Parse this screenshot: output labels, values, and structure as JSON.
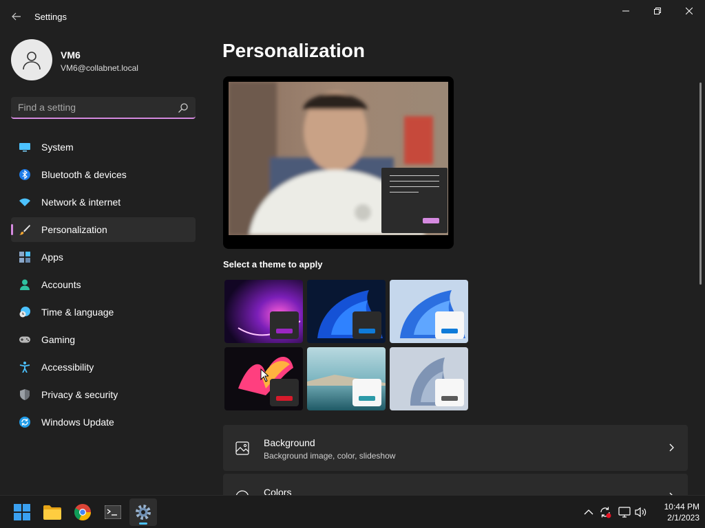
{
  "window": {
    "title": "Settings"
  },
  "profile": {
    "name": "VM6",
    "email": "VM6@collabnet.local"
  },
  "search": {
    "placeholder": "Find a setting"
  },
  "nav": {
    "items": [
      {
        "label": "System",
        "icon": "monitor-icon",
        "active": false
      },
      {
        "label": "Bluetooth & devices",
        "icon": "bluetooth-icon",
        "active": false
      },
      {
        "label": "Network & internet",
        "icon": "wifi-icon",
        "active": false
      },
      {
        "label": "Personalization",
        "icon": "brush-icon",
        "active": true
      },
      {
        "label": "Apps",
        "icon": "apps-icon",
        "active": false
      },
      {
        "label": "Accounts",
        "icon": "person-icon",
        "active": false
      },
      {
        "label": "Time & language",
        "icon": "clock-globe-icon",
        "active": false
      },
      {
        "label": "Gaming",
        "icon": "gamepad-icon",
        "active": false
      },
      {
        "label": "Accessibility",
        "icon": "accessibility-icon",
        "active": false
      },
      {
        "label": "Privacy & security",
        "icon": "shield-icon",
        "active": false
      },
      {
        "label": "Windows Update",
        "icon": "update-icon",
        "active": false
      }
    ]
  },
  "main": {
    "title": "Personalization",
    "themes_label": "Select a theme to apply",
    "rows": [
      {
        "title": "Background",
        "subtitle": "Background image, color, slideshow",
        "icon": "image-icon"
      },
      {
        "title": "Colors",
        "subtitle": "",
        "icon": "palette-icon"
      }
    ]
  },
  "theme_colors": {
    "accent": "#d58ae0",
    "background": "#202020",
    "card": "#2b2b2b"
  },
  "taskbar": {
    "time": "10:44 PM",
    "date": "2/1/2023"
  }
}
